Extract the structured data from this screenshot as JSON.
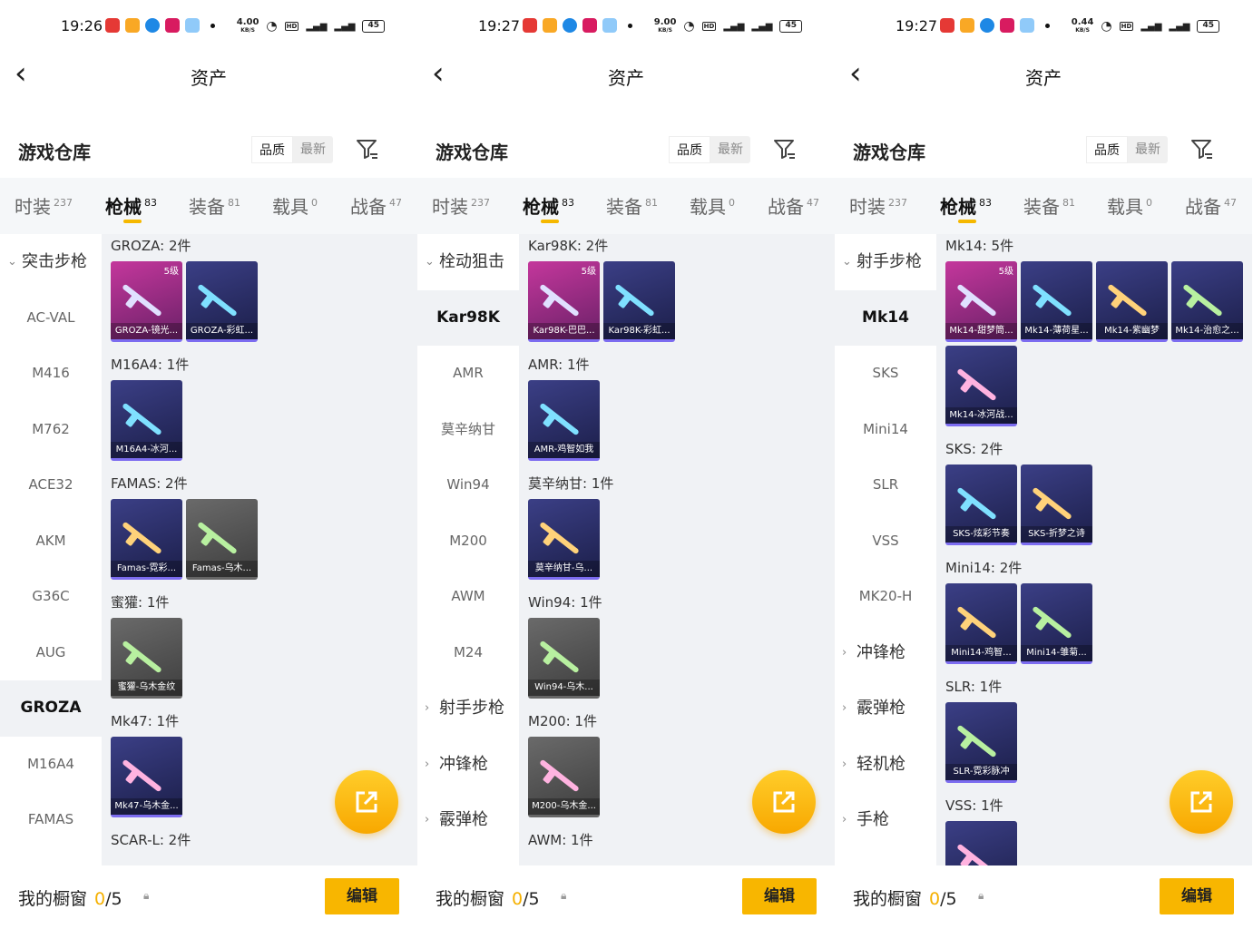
{
  "colors": {
    "accent": "#f5b800",
    "panel_bg": "#f0f2f5"
  },
  "panels": [
    {
      "status": {
        "time": "19:26",
        "net_speed": "4.00",
        "net_unit": "KB/S",
        "battery": "45"
      },
      "header": {
        "title": "资产",
        "back_icon": "chevron-left-icon"
      },
      "warehouse": {
        "label": "游戏仓库",
        "sort_quality": "品质",
        "sort_newest": "最新",
        "filter_icon": "filter-icon"
      },
      "tabs": [
        {
          "label": "时装",
          "count": "237"
        },
        {
          "label": "枪械",
          "count": "83",
          "active": true
        },
        {
          "label": "装备",
          "count": "81"
        },
        {
          "label": "载具",
          "count": "0"
        },
        {
          "label": "战备",
          "count": "47"
        }
      ],
      "sidebar": [
        {
          "label": "突击步枪",
          "type": "cat",
          "expanded": true
        },
        {
          "label": "AC-VAL"
        },
        {
          "label": "M416"
        },
        {
          "label": "M762"
        },
        {
          "label": "ACE32"
        },
        {
          "label": "AKM"
        },
        {
          "label": "G36C"
        },
        {
          "label": "AUG"
        },
        {
          "label": "GROZA",
          "selected": true
        },
        {
          "label": "M16A4"
        },
        {
          "label": "FAMAS"
        }
      ],
      "groups": [
        {
          "title": "GROZA: 2件",
          "items": [
            {
              "name": "GROZA-镜光...",
              "level": "5级",
              "style": "pink"
            },
            {
              "name": "GROZA-彩虹...",
              "style": "purple"
            }
          ]
        },
        {
          "title": "M16A4: 1件",
          "items": [
            {
              "name": "M16A4-冰河...",
              "style": "purple"
            }
          ]
        },
        {
          "title": "FAMAS: 2件",
          "items": [
            {
              "name": "Famas-霓彩...",
              "style": "purple"
            },
            {
              "name": "Famas-乌木...",
              "style": "grey"
            }
          ]
        },
        {
          "title": "蜜獾: 1件",
          "items": [
            {
              "name": "蜜獾-乌木金纹",
              "style": "grey"
            }
          ]
        },
        {
          "title": "Mk47: 1件",
          "items": [
            {
              "name": "Mk47-乌木金...",
              "style": "purple"
            }
          ]
        },
        {
          "title": "SCAR-L: 2件",
          "items": []
        }
      ],
      "bottom": {
        "label": "我的橱窗",
        "count": "0",
        "max": "/5",
        "edit": "编辑"
      }
    },
    {
      "status": {
        "time": "19:27",
        "net_speed": "9.00",
        "net_unit": "KB/S",
        "battery": "45"
      },
      "header": {
        "title": "资产",
        "back_icon": "chevron-left-icon"
      },
      "warehouse": {
        "label": "游戏仓库",
        "sort_quality": "品质",
        "sort_newest": "最新",
        "filter_icon": "filter-icon"
      },
      "tabs": [
        {
          "label": "时装",
          "count": "237"
        },
        {
          "label": "枪械",
          "count": "83",
          "active": true
        },
        {
          "label": "装备",
          "count": "81"
        },
        {
          "label": "载具",
          "count": "0"
        },
        {
          "label": "战备",
          "count": "47"
        }
      ],
      "sidebar": [
        {
          "label": "栓动狙击",
          "type": "cat",
          "expanded": true
        },
        {
          "label": "Kar98K",
          "selected": true
        },
        {
          "label": "AMR"
        },
        {
          "label": "莫辛纳甘"
        },
        {
          "label": "Win94"
        },
        {
          "label": "M200"
        },
        {
          "label": "AWM"
        },
        {
          "label": "M24"
        },
        {
          "label": "射手步枪",
          "type": "cat"
        },
        {
          "label": "冲锋枪",
          "type": "cat"
        },
        {
          "label": "霰弹枪",
          "type": "cat"
        }
      ],
      "groups": [
        {
          "title": "Kar98K: 2件",
          "items": [
            {
              "name": "Kar98K-巴巴...",
              "level": "5级",
              "style": "pink"
            },
            {
              "name": "Kar98K-彩虹...",
              "style": "purple"
            }
          ]
        },
        {
          "title": "AMR: 1件",
          "items": [
            {
              "name": "AMR-鸡智如我",
              "style": "purple"
            }
          ]
        },
        {
          "title": "莫辛纳甘: 1件",
          "items": [
            {
              "name": "莫辛纳甘-乌...",
              "style": "purple"
            }
          ]
        },
        {
          "title": "Win94: 1件",
          "items": [
            {
              "name": "Win94-乌木...",
              "style": "grey"
            }
          ]
        },
        {
          "title": "M200: 1件",
          "items": [
            {
              "name": "M200-乌木金...",
              "style": "grey"
            }
          ]
        },
        {
          "title": "AWM: 1件",
          "items": []
        }
      ],
      "bottom": {
        "label": "我的橱窗",
        "count": "0",
        "max": "/5",
        "edit": "编辑"
      }
    },
    {
      "status": {
        "time": "19:27",
        "net_speed": "0.44",
        "net_unit": "KB/S",
        "battery": "45"
      },
      "header": {
        "title": "资产",
        "back_icon": "chevron-left-icon"
      },
      "warehouse": {
        "label": "游戏仓库",
        "sort_quality": "品质",
        "sort_newest": "最新",
        "filter_icon": "filter-icon"
      },
      "tabs": [
        {
          "label": "时装",
          "count": "237"
        },
        {
          "label": "枪械",
          "count": "83",
          "active": true
        },
        {
          "label": "装备",
          "count": "81"
        },
        {
          "label": "载具",
          "count": "0"
        },
        {
          "label": "战备",
          "count": "47"
        }
      ],
      "sidebar": [
        {
          "label": "射手步枪",
          "type": "cat",
          "expanded": true
        },
        {
          "label": "Mk14",
          "selected": true
        },
        {
          "label": "SKS"
        },
        {
          "label": "Mini14"
        },
        {
          "label": "SLR"
        },
        {
          "label": "VSS"
        },
        {
          "label": "MK20-H"
        },
        {
          "label": "冲锋枪",
          "type": "cat"
        },
        {
          "label": "霰弹枪",
          "type": "cat"
        },
        {
          "label": "轻机枪",
          "type": "cat"
        },
        {
          "label": "手枪",
          "type": "cat"
        }
      ],
      "groups": [
        {
          "title": "Mk14: 5件",
          "items": [
            {
              "name": "Mk14-甜梦筒...",
              "level": "5级",
              "style": "pink"
            },
            {
              "name": "Mk14-薄荷星...",
              "style": "purple"
            },
            {
              "name": "Mk14-紫幽梦",
              "style": "purple"
            },
            {
              "name": "Mk14-治愈之...",
              "style": "purple"
            },
            {
              "name": "Mk14-冰河战...",
              "style": "purple"
            }
          ]
        },
        {
          "title": "SKS: 2件",
          "items": [
            {
              "name": "SKS-炫彩节奏",
              "style": "purple"
            },
            {
              "name": "SKS-折梦之诗",
              "style": "purple"
            }
          ]
        },
        {
          "title": "Mini14: 2件",
          "items": [
            {
              "name": "Mini14-鸡智...",
              "style": "purple"
            },
            {
              "name": "Mini14-雏菊...",
              "style": "purple"
            }
          ]
        },
        {
          "title": "SLR: 1件",
          "items": [
            {
              "name": "SLR-霓彩脉冲",
              "style": "purple"
            }
          ]
        },
        {
          "title": "VSS: 1件",
          "items": [
            {
              "name": "",
              "style": "purple"
            }
          ]
        }
      ],
      "bottom": {
        "label": "我的橱窗",
        "count": "0",
        "max": "/5",
        "edit": "编辑"
      }
    }
  ]
}
